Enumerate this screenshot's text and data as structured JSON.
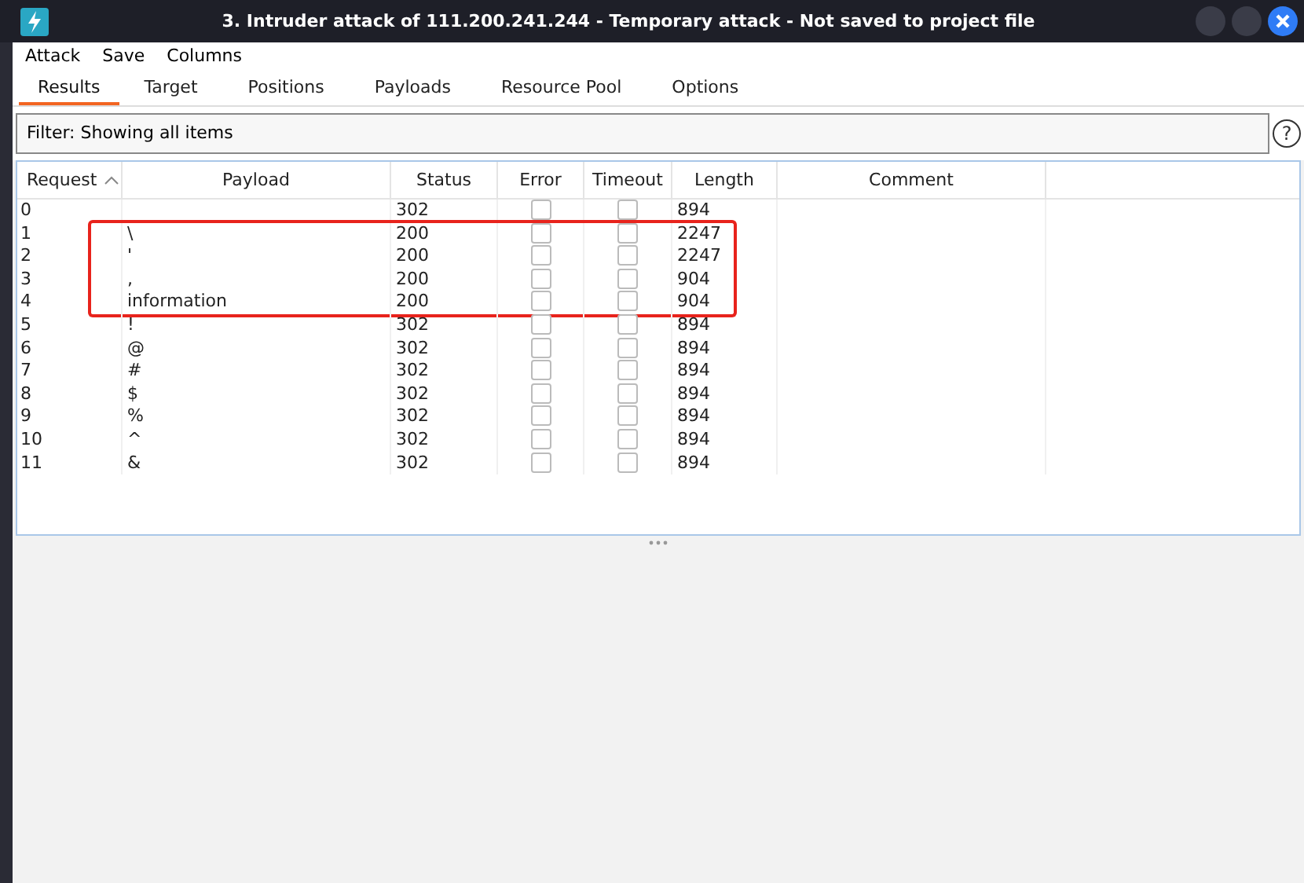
{
  "window": {
    "title": "3. Intruder attack of 111.200.241.244 - Temporary attack - Not saved to project file"
  },
  "menu": [
    "Attack",
    "Save",
    "Columns"
  ],
  "tabs": [
    {
      "label": "Results",
      "selected": true
    },
    {
      "label": "Target",
      "selected": false
    },
    {
      "label": "Positions",
      "selected": false
    },
    {
      "label": "Payloads",
      "selected": false
    },
    {
      "label": "Resource Pool",
      "selected": false
    },
    {
      "label": "Options",
      "selected": false
    }
  ],
  "filter": {
    "value": "Filter: Showing all items",
    "help": "?"
  },
  "table": {
    "columns": [
      "Request",
      "Payload",
      "Status",
      "Error",
      "Timeout",
      "Length",
      "Comment"
    ],
    "rows": [
      {
        "request": "0",
        "payload": "",
        "status": "302",
        "error": false,
        "timeout": false,
        "length": "894",
        "highlighted": false
      },
      {
        "request": "1",
        "payload": "\\",
        "status": "200",
        "error": false,
        "timeout": false,
        "length": "2247",
        "highlighted": true
      },
      {
        "request": "2",
        "payload": "'",
        "status": "200",
        "error": false,
        "timeout": false,
        "length": "2247",
        "highlighted": true
      },
      {
        "request": "3",
        "payload": ",",
        "status": "200",
        "error": false,
        "timeout": false,
        "length": "904",
        "highlighted": true
      },
      {
        "request": "4",
        "payload": "information",
        "status": "200",
        "error": false,
        "timeout": false,
        "length": "904",
        "highlighted": true
      },
      {
        "request": "5",
        "payload": "!",
        "status": "302",
        "error": false,
        "timeout": false,
        "length": "894",
        "highlighted": false
      },
      {
        "request": "6",
        "payload": "@",
        "status": "302",
        "error": false,
        "timeout": false,
        "length": "894",
        "highlighted": false
      },
      {
        "request": "7",
        "payload": "#",
        "status": "302",
        "error": false,
        "timeout": false,
        "length": "894",
        "highlighted": false
      },
      {
        "request": "8",
        "payload": "$",
        "status": "302",
        "error": false,
        "timeout": false,
        "length": "894",
        "highlighted": false
      },
      {
        "request": "9",
        "payload": "%",
        "status": "302",
        "error": false,
        "timeout": false,
        "length": "894",
        "highlighted": false
      },
      {
        "request": "10",
        "payload": "^",
        "status": "302",
        "error": false,
        "timeout": false,
        "length": "894",
        "highlighted": false
      },
      {
        "request": "11",
        "payload": "&",
        "status": "302",
        "error": false,
        "timeout": false,
        "length": "894",
        "highlighted": false
      }
    ]
  }
}
